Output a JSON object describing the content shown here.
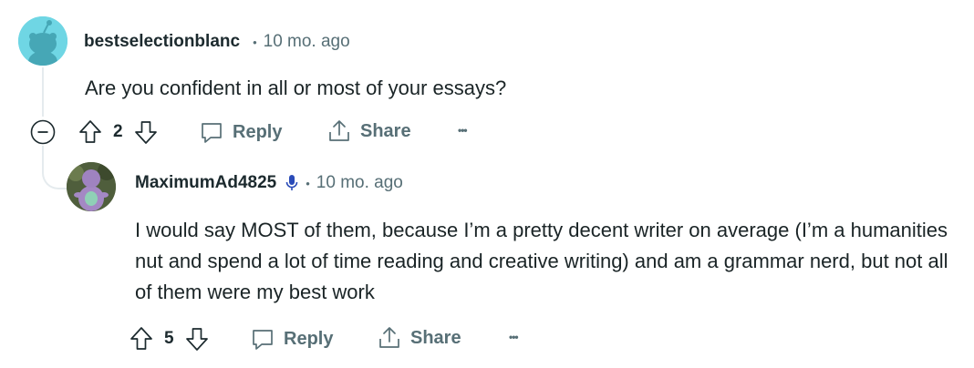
{
  "comment1": {
    "username": "bestselectionblanc",
    "separator": "•",
    "time": "10 mo. ago",
    "body": "Are you confident in all or most of your essays?",
    "votes": "2",
    "reply_label": "Reply",
    "share_label": "Share",
    "more_label": "•••"
  },
  "comment2": {
    "username": "MaximumAd4825",
    "separator": "•",
    "time": "10 mo. ago",
    "body": "I would say MOST of them, because I’m a pretty decent writer on average (I’m a humanities nut and spend a lot of time reading and creative writing) and am a grammar nerd, but not all of them were my best work",
    "votes": "5",
    "reply_label": "Reply",
    "share_label": "Share",
    "more_label": "•••"
  },
  "colors": {
    "text": "#1a2426",
    "muted": "#576f76",
    "thread_line": "#e5ebee",
    "avatar1_bg": "#6fd6e4",
    "mic_icon": "#2a4bb8"
  }
}
